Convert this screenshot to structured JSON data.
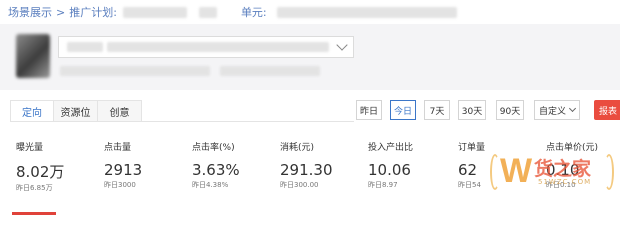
{
  "breadcrumb": {
    "root": "场景展示",
    "sep": ">",
    "plan_label": "推广计划:",
    "unit_label": "单元:"
  },
  "tabs": [
    {
      "label": "定向",
      "active": true
    },
    {
      "label": "资源位",
      "active": false
    },
    {
      "label": "创意",
      "active": false
    }
  ],
  "date_ranges": [
    {
      "label": "昨日",
      "active": false
    },
    {
      "label": "今日",
      "active": true
    },
    {
      "label": "7天",
      "active": false
    },
    {
      "label": "30天",
      "active": false
    },
    {
      "label": "90天",
      "active": false
    },
    {
      "label": "自定义",
      "active": false
    }
  ],
  "report_button": "报表",
  "metrics": [
    {
      "label": "曝光量",
      "value": "8.02万",
      "yesterday": "昨日6.85万"
    },
    {
      "label": "点击量",
      "value": "2913",
      "yesterday": "昨日3000"
    },
    {
      "label": "点击率(%)",
      "value": "3.63%",
      "yesterday": "昨日4.38%"
    },
    {
      "label": "消耗(元)",
      "value": "291.30",
      "yesterday": "昨日300.00"
    },
    {
      "label": "投入产出比",
      "value": "10.06",
      "yesterday": "昨日8.97"
    },
    {
      "label": "订单量",
      "value": "62",
      "yesterday": "昨日54"
    },
    {
      "label": "点击单价(元)",
      "value": "0.10",
      "yesterday": "昨日0.10"
    }
  ],
  "watermark": {
    "text": "货之家",
    "sub": "51WZC.COM"
  },
  "colors": {
    "link": "#5b7fbf",
    "accent": "#3b76c8",
    "report": "#ea4c3f"
  }
}
